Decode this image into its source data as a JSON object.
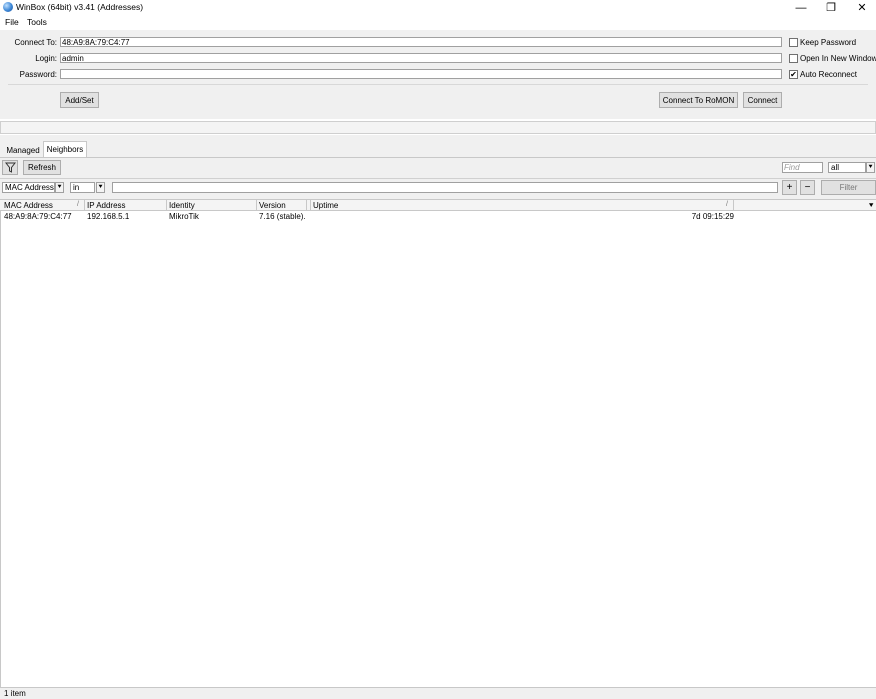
{
  "window": {
    "title": "WinBox (64bit) v3.41 (Addresses)",
    "minimize_glyph": "—",
    "restore_glyph": "❐",
    "close_glyph": "✕"
  },
  "menu": [
    "File",
    "Tools"
  ],
  "login": {
    "connect_to_label": "Connect To:",
    "connect_to_value": "48:A9:8A:79:C4:77",
    "login_label": "Login:",
    "login_value": "admin",
    "password_label": "Password:",
    "password_value": "",
    "keep_password_label": "Keep Password",
    "keep_password_checked": false,
    "open_new_window_label": "Open In New Window",
    "open_new_window_checked": false,
    "auto_reconnect_label": "Auto Reconnect",
    "auto_reconnect_checked": true,
    "add_set_label": "Add/Set",
    "connect_romon_label": "Connect To RoMON",
    "connect_label": "Connect"
  },
  "tabs": [
    {
      "label": "Managed",
      "active": false
    },
    {
      "label": "Neighbors",
      "active": true
    }
  ],
  "toolbar": {
    "refresh_label": "Refresh",
    "find_placeholder": "Find",
    "find_scope": "all"
  },
  "filter": {
    "field": "MAC Address",
    "operator": "in",
    "value": "",
    "plus": "+",
    "minus": "−",
    "filter_label": "Filter"
  },
  "table": {
    "columns": [
      "MAC Address",
      "IP Address",
      "Identity",
      "Version",
      "Uptime"
    ],
    "rows": [
      {
        "mac": "48:A9:8A:79:C4:77",
        "ip": "192.168.5.1",
        "identity": "MikroTik",
        "version": "7.16 (stable)...",
        "uptime": "7d 09:15:29"
      }
    ]
  },
  "status": "1 item"
}
